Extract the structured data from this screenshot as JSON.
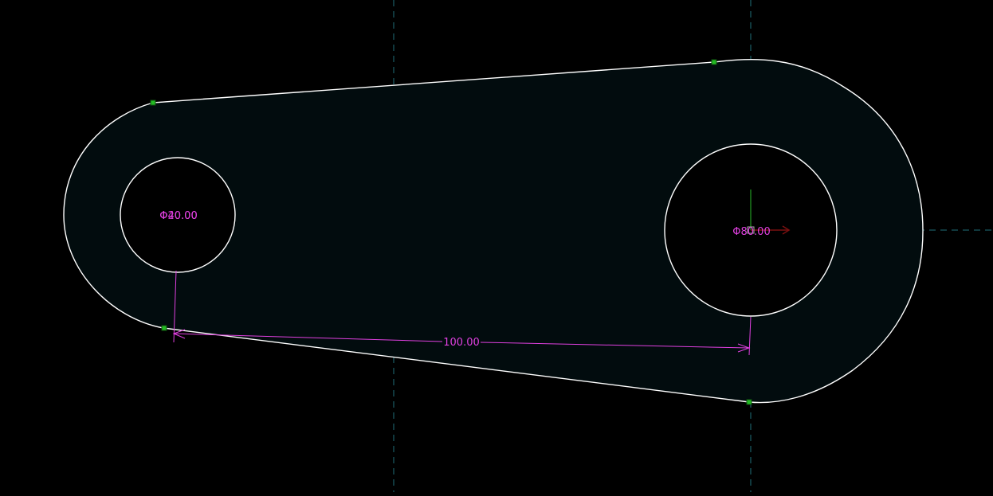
{
  "viewport": {
    "background": "#000000",
    "colors": {
      "profile_fill": "#020c0e",
      "profile_stroke": "#ffffff",
      "axis_line": "#1f6f7a",
      "dimension": "#e040e0",
      "grip": "#22bb22",
      "origin_x_arrow": "#7a1010",
      "origin_y_arrow": "#1a7a1a"
    },
    "icons": {
      "origin": "ucs-origin-icon",
      "grip": "grip-point-icon"
    }
  },
  "dimensions": {
    "small_hole_diameter": "Φ40.00",
    "small_hole_diameter_overlap": "Φ20.00",
    "large_hole_diameter": "Φ80.00",
    "center_distance": "100.00"
  }
}
